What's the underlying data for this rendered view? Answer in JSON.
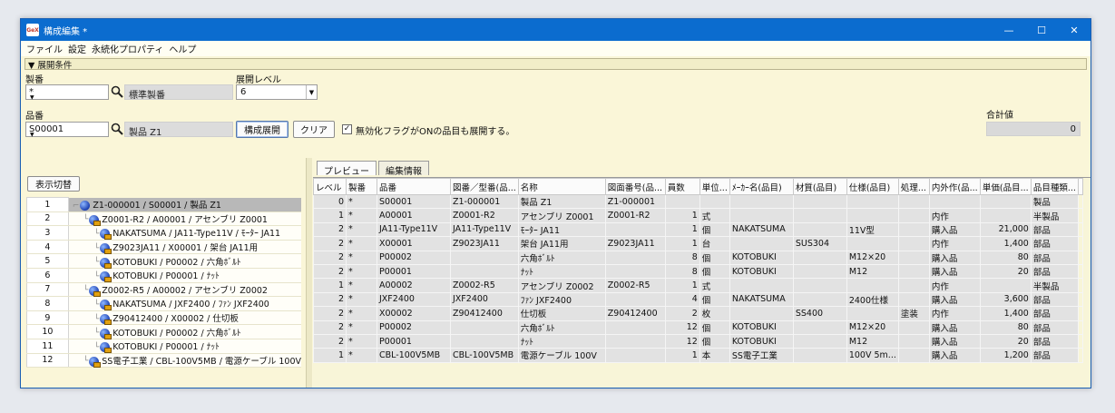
{
  "window": {
    "app_icon_text": "GeX",
    "title": "構成編集 *",
    "controls": [
      "—",
      "☐",
      "✕"
    ]
  },
  "menu": [
    "ファイル",
    "設定",
    "永続化プロパティ",
    "ヘルプ"
  ],
  "section": {
    "title": "▼ 展開条件"
  },
  "conditions": {
    "seiban_label": "製番",
    "seiban_value": "*",
    "seiban_name": "標準製番",
    "level_label": "展開レベル",
    "level_value": "6",
    "hinban_label": "品番",
    "hinban_value": "S00001",
    "hinban_name": "製品 Z1",
    "expand_button": "構成展開",
    "clear_button": "クリア",
    "checkbox_label": "無効化フラグがONの品目も展開する。",
    "checkbox_checked": true,
    "total_label": "合計値",
    "total_value": "0"
  },
  "left": {
    "toggle_button": "表示切替",
    "tree_rows": [
      {
        "no": "1",
        "text": "Z1-000001 / S00001 / 製品 Z1",
        "depth": 0,
        "type": "root",
        "selected": true
      },
      {
        "no": "2",
        "text": "Z0001-R2 / A00001 / アセンブリ Z0001",
        "depth": 1,
        "type": "sub"
      },
      {
        "no": "3",
        "text": "NAKATSUMA / JA11-Type11V / ﾓｰﾀｰ JA11",
        "depth": 2,
        "type": "sub"
      },
      {
        "no": "4",
        "text": "Z9023JA11 / X00001 / 架台 JA11用",
        "depth": 2,
        "type": "sub"
      },
      {
        "no": "5",
        "text": "KOTOBUKI / P00002 / 六角ﾎﾞﾙﾄ",
        "depth": 2,
        "type": "sub"
      },
      {
        "no": "6",
        "text": "KOTOBUKI / P00001 / ﾅｯﾄ",
        "depth": 2,
        "type": "sub"
      },
      {
        "no": "7",
        "text": "Z0002-R5 / A00002 / アセンブリ Z0002",
        "depth": 1,
        "type": "sub"
      },
      {
        "no": "8",
        "text": "NAKATSUMA / JXF2400 / ﾌｧﾝ JXF2400",
        "depth": 2,
        "type": "sub"
      },
      {
        "no": "9",
        "text": "Z90412400 / X00002 / 仕切板",
        "depth": 2,
        "type": "sub"
      },
      {
        "no": "10",
        "text": "KOTOBUKI / P00002 / 六角ﾎﾞﾙﾄ",
        "depth": 2,
        "type": "sub"
      },
      {
        "no": "11",
        "text": "KOTOBUKI / P00001 / ﾅｯﾄ",
        "depth": 2,
        "type": "sub"
      },
      {
        "no": "12",
        "text": "SS電子工業 / CBL-100V5MB / 電源ケーブル 100V",
        "depth": 1,
        "type": "sub"
      }
    ]
  },
  "tabs": [
    "プレビュー",
    "編集情報"
  ],
  "grid": {
    "columns": [
      "レベル",
      "製番",
      "品番",
      "図番／型番(品...",
      "名称",
      "図面番号(品...",
      "員数",
      "単位...",
      "ﾒｰｶｰ名(品目)",
      "材質(品目)",
      "仕様(品目)",
      "処理...",
      "内外作(品...",
      "単価(品目...",
      "品目種類..."
    ],
    "rows": [
      [
        "0",
        "*",
        "S00001",
        "Z1-000001",
        "製品 Z1",
        "Z1-000001",
        "",
        "",
        "",
        "",
        "",
        "",
        "",
        "",
        "製品"
      ],
      [
        "1",
        "*",
        "A00001",
        "Z0001-R2",
        "アセンブリ Z0001",
        "Z0001-R2",
        "1",
        "式",
        "",
        "",
        "",
        "",
        "内作",
        "",
        "半製品"
      ],
      [
        "2",
        "*",
        "JA11-Type11V",
        "JA11-Type11V",
        "ﾓｰﾀｰ JA11",
        "",
        "1",
        "個",
        "NAKATSUMA",
        "",
        "11V型",
        "",
        "購入品",
        "21,000",
        "部品"
      ],
      [
        "2",
        "*",
        "X00001",
        "Z9023JA11",
        "架台 JA11用",
        "Z9023JA11",
        "1",
        "台",
        "",
        "SUS304",
        "",
        "",
        "内作",
        "1,400",
        "部品"
      ],
      [
        "2",
        "*",
        "P00002",
        "",
        "六角ﾎﾞﾙﾄ",
        "",
        "8",
        "個",
        "KOTOBUKI",
        "",
        "M12×20",
        "",
        "購入品",
        "80",
        "部品"
      ],
      [
        "2",
        "*",
        "P00001",
        "",
        "ﾅｯﾄ",
        "",
        "8",
        "個",
        "KOTOBUKI",
        "",
        "M12",
        "",
        "購入品",
        "20",
        "部品"
      ],
      [
        "1",
        "*",
        "A00002",
        "Z0002-R5",
        "アセンブリ Z0002",
        "Z0002-R5",
        "1",
        "式",
        "",
        "",
        "",
        "",
        "内作",
        "",
        "半製品"
      ],
      [
        "2",
        "*",
        "JXF2400",
        "JXF2400",
        "ﾌｧﾝ JXF2400",
        "",
        "4",
        "個",
        "NAKATSUMA",
        "",
        "2400仕様",
        "",
        "購入品",
        "3,600",
        "部品"
      ],
      [
        "2",
        "*",
        "X00002",
        "Z90412400",
        "仕切板",
        "Z90412400",
        "2",
        "枚",
        "",
        "SS400",
        "",
        "塗装",
        "内作",
        "1,400",
        "部品"
      ],
      [
        "2",
        "*",
        "P00002",
        "",
        "六角ﾎﾞﾙﾄ",
        "",
        "12",
        "個",
        "KOTOBUKI",
        "",
        "M12×20",
        "",
        "購入品",
        "80",
        "部品"
      ],
      [
        "2",
        "*",
        "P00001",
        "",
        "ﾅｯﾄ",
        "",
        "12",
        "個",
        "KOTOBUKI",
        "",
        "M12",
        "",
        "購入品",
        "20",
        "部品"
      ],
      [
        "1",
        "*",
        "CBL-100V5MB",
        "CBL-100V5MB",
        "電源ケーブル 100V",
        "",
        "1",
        "本",
        "SS電子工業",
        "",
        "100V 5m...",
        "",
        "購入品",
        "1,200",
        "部品"
      ]
    ]
  }
}
